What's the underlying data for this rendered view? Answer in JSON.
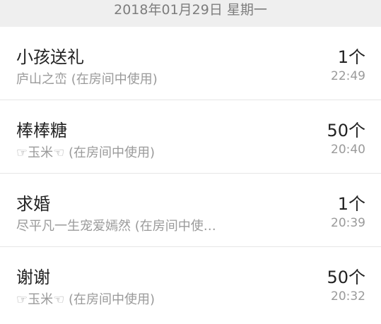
{
  "date_header": "2018年01月29日 星期一",
  "records": [
    {
      "gift": "小孩送礼",
      "sender": "庐山之峦",
      "note": "(在房间中使用)",
      "quantity": "1个",
      "time": "22:49"
    },
    {
      "gift": "棒棒糖",
      "sender": "☞玉米☜",
      "note": "(在房间中使用)",
      "quantity": "50个",
      "time": "20:40"
    },
    {
      "gift": "求婚",
      "sender": "尽平凡一生宠爱嫣然",
      "note": "(在房间中使…",
      "quantity": "1个",
      "time": "20:39"
    },
    {
      "gift": "谢谢",
      "sender": "☞玉米☜",
      "note": "(在房间中使用)",
      "quantity": "50个",
      "time": "20:32"
    }
  ]
}
